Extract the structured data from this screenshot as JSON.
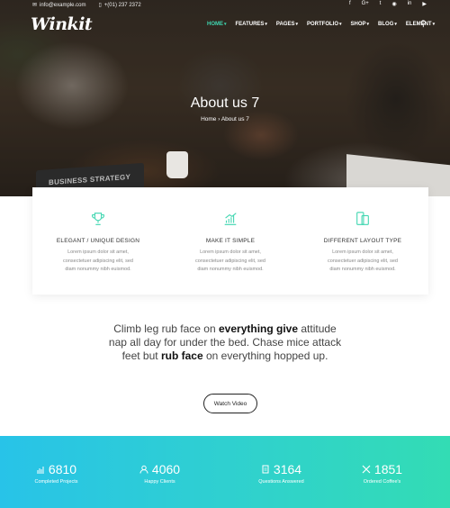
{
  "topbar": {
    "email": "info@example.com",
    "phone": "+(01) 237 2372",
    "social": [
      "f",
      "G+",
      "t",
      "◉",
      "in",
      "▶"
    ]
  },
  "nav": {
    "logo": "Winkit",
    "items": [
      {
        "label": "HOME",
        "active": true
      },
      {
        "label": "FEATURES",
        "active": false
      },
      {
        "label": "PAGES",
        "active": false
      },
      {
        "label": "PORTFOLIO",
        "active": false
      },
      {
        "label": "SHOP",
        "active": false
      },
      {
        "label": "BLOG",
        "active": false
      },
      {
        "label": "ELEMENT",
        "active": false
      }
    ],
    "accent": "#3fd6b0"
  },
  "hero": {
    "title": "About us 7",
    "breadcrumb_home": "Home",
    "breadcrumb_sep": "›",
    "breadcrumb_current": "About us 7",
    "laptop_text": "BUSINESS STRATEGY"
  },
  "features": [
    {
      "icon": "trophy-icon",
      "title": "ELEGANT / UNIQUE DESIGN",
      "text": "Lorem ipsum dolor sit amet, consectetuer adipiscing elit, sed diam nonummy nibh euismod."
    },
    {
      "icon": "chart-icon",
      "title": "MAKE IT SIMPLE",
      "text": "Lorem ipsum dolor sit amet, consectetuer adipiscing elit, sed diam nonummy nibh euismod."
    },
    {
      "icon": "devices-icon",
      "title": "DIFFERENT LAYOUT TYPE",
      "text": "Lorem ipsum dolor sit amet, consectetuer adipiscing elit, sed diam nonummy nibh euismod."
    }
  ],
  "quote": {
    "part1": "Climb leg rub face on ",
    "bold1": "everything give",
    "part2": " attitude nap all day for under the bed. Chase mice attack feet but ",
    "bold2": "rub face",
    "part3": " on everything hopped up."
  },
  "watch_label": "Watch Video",
  "stats": [
    {
      "icon": "chart-icon",
      "value": "6810",
      "label": "Completed Projects"
    },
    {
      "icon": "user-icon",
      "value": "4060",
      "label": "Happy Clients"
    },
    {
      "icon": "document-icon",
      "value": "3164",
      "label": "Questions Answered"
    },
    {
      "icon": "tools-icon",
      "value": "1851",
      "label": "Ordered Coffee's"
    }
  ],
  "colors": {
    "teal": "#3fd6b0",
    "gradient_start": "#28c3e8",
    "gradient_end": "#33dcb4"
  }
}
